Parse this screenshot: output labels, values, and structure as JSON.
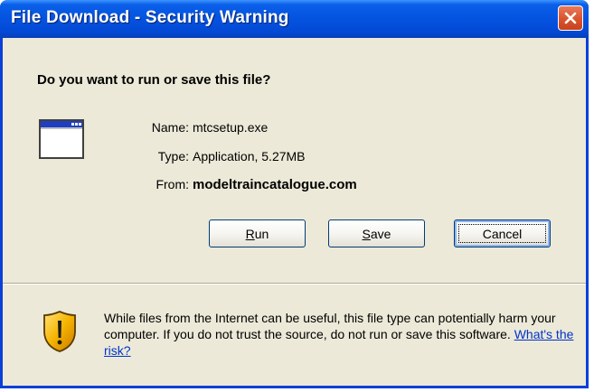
{
  "window": {
    "title": "File Download - Security Warning"
  },
  "question": "Do you want to run or save this file?",
  "file": {
    "name_label": "Name:",
    "name_value": "mtcsetup.exe",
    "type_label": "Type:",
    "type_value": "Application, 5.27MB",
    "from_label": "From:",
    "from_value": "modeltraincatalogue.com"
  },
  "buttons": {
    "run_mnemonic": "R",
    "run_rest": "un",
    "save_mnemonic": "S",
    "save_rest": "ave",
    "cancel": "Cancel"
  },
  "warning": {
    "text": "While files from the Internet can be useful, this file type can potentially harm your computer. If you do not trust the source, do not run or save this software. ",
    "link": "What's the risk?"
  },
  "colors": {
    "titlebar": "#0453e0",
    "frame": "#0a3fd8",
    "body": "#ece9d8",
    "close": "#d9532b",
    "link": "#0033cc"
  }
}
